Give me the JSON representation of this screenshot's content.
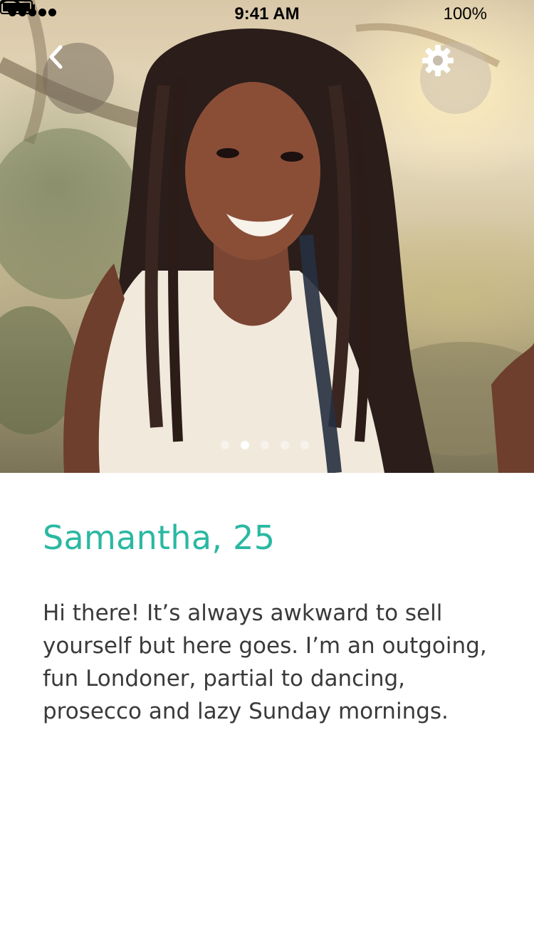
{
  "status_bar": {
    "time": "9:41 AM",
    "battery_percent": "100%",
    "signal_bars": 5
  },
  "photo": {
    "description_icon": "profile-photo",
    "page_count": 5,
    "active_page": 2
  },
  "buttons": {
    "back_icon": "chevron-left-icon",
    "settings_icon": "gear-icon"
  },
  "profile": {
    "name_age": "Samantha, 25",
    "bio": "Hi there! It’s always awkward to sell yourself but here goes. I’m an outgoing, fun Londoner, partial to dancing, prosecco and lazy Sunday mornings."
  },
  "colors": {
    "accent": "#2ab8a2",
    "body_text": "#3a3a3a"
  }
}
